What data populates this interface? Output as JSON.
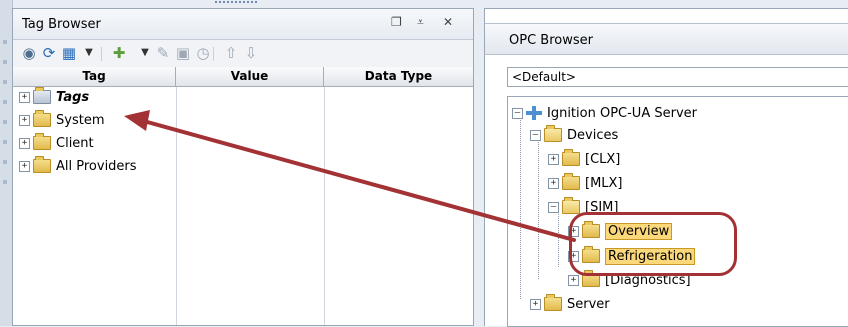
{
  "tag_browser": {
    "title": "Tag Browser",
    "header_buttons": [
      "❐",
      "⩡",
      "✕"
    ],
    "columns": [
      "Tag",
      "Value",
      "Data Type"
    ],
    "rows": [
      {
        "label": "Tags",
        "icon": "tag-folder-icon"
      },
      {
        "label": "System",
        "icon": "folder-icon"
      },
      {
        "label": "Client",
        "icon": "folder-icon"
      },
      {
        "label": "All Providers",
        "icon": "folder-icon"
      }
    ]
  },
  "opc_browser": {
    "title": "OPC Browser",
    "connection": "<Default>",
    "tree": {
      "server": "Ignition OPC-UA Server",
      "devices": "Devices",
      "clx": "[CLX]",
      "mlx": "[MLX]",
      "sim": "[SIM]",
      "overview": "Overview",
      "refrigeration": "Refrigeration",
      "diagnostics": "[Diagnostics]",
      "server_node": "Server"
    }
  },
  "colors": {
    "highlight_ring": "#a33235",
    "arrow": "#a33235",
    "selection": "#fbd879"
  }
}
